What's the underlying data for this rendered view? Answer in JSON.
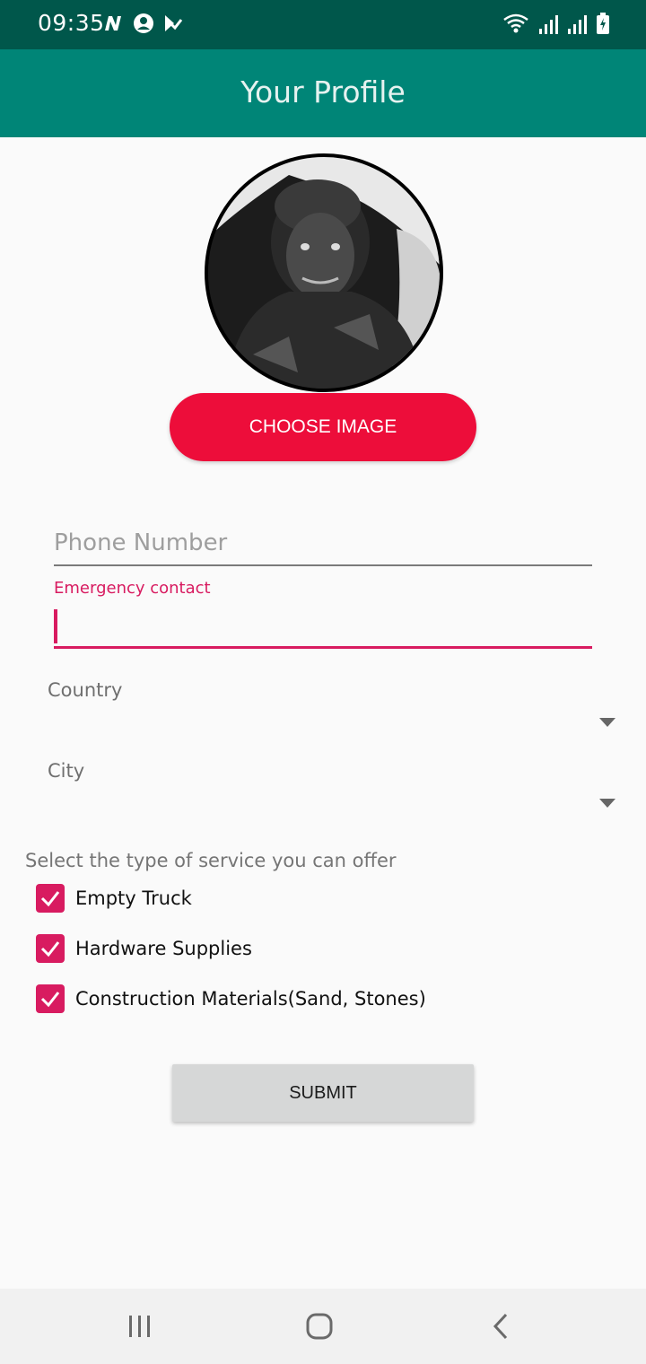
{
  "status_bar": {
    "time": "09:35",
    "left_icons": [
      "n-icon",
      "account-icon",
      "tasks-icon"
    ],
    "right_icons": [
      "wifi-icon",
      "signal-icon",
      "signal-icon",
      "battery-icon"
    ]
  },
  "app_bar": {
    "title": "Your Profile"
  },
  "profile": {
    "choose_image_label": "CHOOSE IMAGE"
  },
  "form": {
    "phone_placeholder": "Phone Number",
    "emergency_label": "Emergency contact",
    "emergency_value": "",
    "country_label": "Country",
    "city_label": "City"
  },
  "services": {
    "prompt": "Select the type of service you can offer",
    "options": [
      {
        "label": "Empty Truck",
        "checked": true
      },
      {
        "label": "Hardware Supplies",
        "checked": true
      },
      {
        "label": "Construction Materials(Sand, Stones)",
        "checked": true
      }
    ]
  },
  "submit_label": "SUBMIT",
  "colors": {
    "status_bar": "#00574b",
    "app_bar": "#008577",
    "accent": "#d81b60",
    "choose_button": "#ed0d3a",
    "submit_button": "#d6d7d7"
  }
}
